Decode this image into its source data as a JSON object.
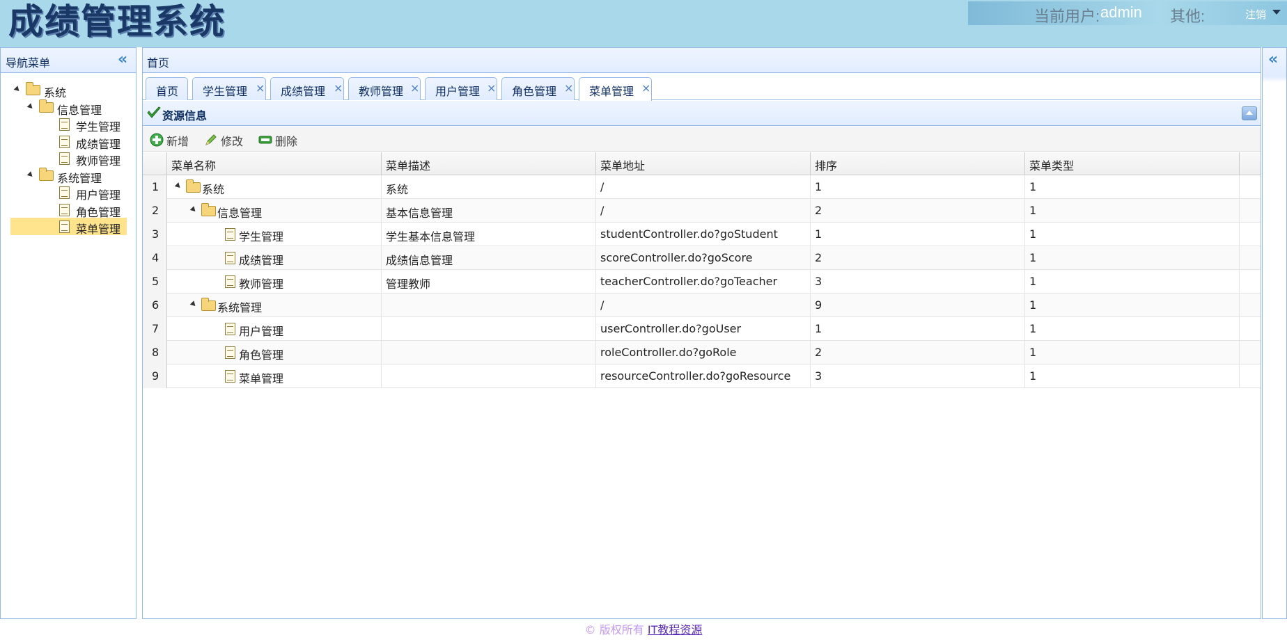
{
  "header": {
    "logo": "成绩管理系统",
    "current_user_label": "当前用户:",
    "current_user": "admin",
    "other_label": "其他:",
    "logout": "注销"
  },
  "nav": {
    "title": "导航菜单",
    "tree": [
      {
        "label": "系统",
        "type": "folder",
        "level": 0
      },
      {
        "label": "信息管理",
        "type": "folder",
        "level": 1
      },
      {
        "label": "学生管理",
        "type": "file",
        "level": 2
      },
      {
        "label": "成绩管理",
        "type": "file",
        "level": 2
      },
      {
        "label": "教师管理",
        "type": "file",
        "level": 2
      },
      {
        "label": "系统管理",
        "type": "folder",
        "level": 1
      },
      {
        "label": "用户管理",
        "type": "file",
        "level": 2
      },
      {
        "label": "角色管理",
        "type": "file",
        "level": 2
      },
      {
        "label": "菜单管理",
        "type": "file",
        "level": 2,
        "selected": true
      }
    ]
  },
  "main": {
    "title": "首页",
    "tabs": [
      {
        "label": "首页",
        "closable": false
      },
      {
        "label": "学生管理",
        "closable": true
      },
      {
        "label": "成绩管理",
        "closable": true
      },
      {
        "label": "教师管理",
        "closable": true
      },
      {
        "label": "用户管理",
        "closable": true
      },
      {
        "label": "角色管理",
        "closable": true
      },
      {
        "label": "菜单管理",
        "closable": true,
        "active": true
      }
    ],
    "panel_title": "资源信息",
    "toolbar": {
      "add": "新增",
      "edit": "修改",
      "delete": "删除"
    },
    "grid": {
      "columns": [
        "菜单名称",
        "菜单描述",
        "菜单地址",
        "排序",
        "菜单类型"
      ],
      "rows": [
        {
          "num": "1",
          "name": "系统",
          "type": "folder",
          "level": 0,
          "desc": "系统",
          "url": "/",
          "order": "1",
          "menu_type": "1"
        },
        {
          "num": "2",
          "name": "信息管理",
          "type": "folder",
          "level": 1,
          "desc": "基本信息管理",
          "url": "/",
          "order": "2",
          "menu_type": "1"
        },
        {
          "num": "3",
          "name": "学生管理",
          "type": "file",
          "level": 2,
          "desc": "学生基本信息管理",
          "url": "studentController.do?goStudent",
          "order": "1",
          "menu_type": "1"
        },
        {
          "num": "4",
          "name": "成绩管理",
          "type": "file",
          "level": 2,
          "desc": "成绩信息管理",
          "url": "scoreController.do?goScore",
          "order": "2",
          "menu_type": "1"
        },
        {
          "num": "5",
          "name": "教师管理",
          "type": "file",
          "level": 2,
          "desc": "管理教师",
          "url": "teacherController.do?goTeacher",
          "order": "3",
          "menu_type": "1"
        },
        {
          "num": "6",
          "name": "系统管理",
          "type": "folder",
          "level": 1,
          "desc": "",
          "url": "/",
          "order": "9",
          "menu_type": "1"
        },
        {
          "num": "7",
          "name": "用户管理",
          "type": "file",
          "level": 2,
          "desc": "",
          "url": "userController.do?goUser",
          "order": "1",
          "menu_type": "1"
        },
        {
          "num": "8",
          "name": "角色管理",
          "type": "file",
          "level": 2,
          "desc": "",
          "url": "roleController.do?goRole",
          "order": "2",
          "menu_type": "1"
        },
        {
          "num": "9",
          "name": "菜单管理",
          "type": "file",
          "level": 2,
          "desc": "",
          "url": "resourceController.do?goResource",
          "order": "3",
          "menu_type": "1"
        }
      ]
    }
  },
  "footer": {
    "copyright": "© 版权所有",
    "link": "IT教程资源"
  },
  "colors": {
    "header_bg": "#a8d8ea",
    "panel_border": "#95b8e7",
    "selected_bg": "#ffe48d",
    "title_color": "#0e2d5f"
  }
}
